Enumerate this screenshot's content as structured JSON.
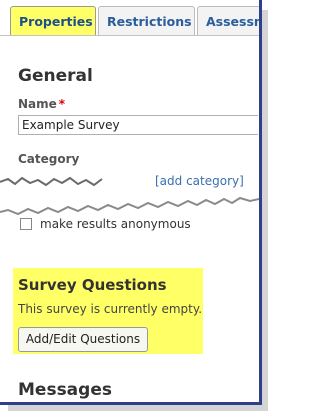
{
  "tabs": [
    {
      "label": "Properties",
      "active": true
    },
    {
      "label": "Restrictions",
      "active": false
    },
    {
      "label": "Assessm",
      "active": false
    }
  ],
  "general": {
    "heading": "General",
    "name_label": "Name",
    "required_marker": "*",
    "name_value": "Example Survey",
    "category_label": "Category",
    "category_link": "[add category]"
  },
  "options": {
    "anonymous_label": "make results anonymous",
    "anonymous_checked": false
  },
  "survey_questions": {
    "heading": "Survey Questions",
    "empty_text": "This survey is currently empty.",
    "button_label": "Add/Edit Questions"
  },
  "messages": {
    "heading": "Messages"
  },
  "colors": {
    "highlight": "#ffff66",
    "frame_border": "#2e3f8c",
    "link": "#3a6fb0",
    "required": "#dd0000"
  }
}
